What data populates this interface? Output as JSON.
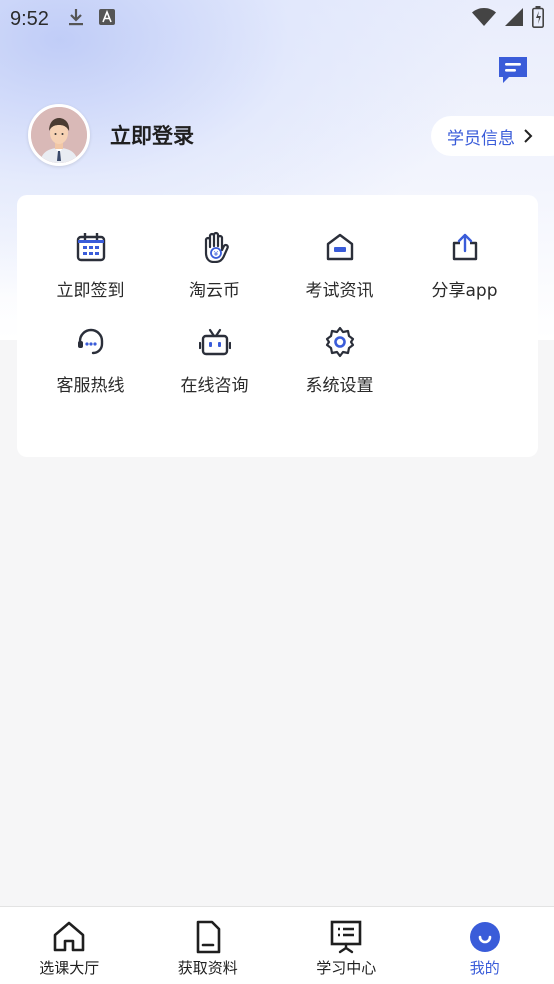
{
  "status_bar": {
    "time": "9:52",
    "left_icons": [
      "download-icon",
      "font-a-icon"
    ],
    "right_icons": [
      "wifi-icon",
      "signal-icon",
      "battery-icon"
    ]
  },
  "header": {
    "login_label": "立即登录",
    "student_info_label": "学员信息",
    "message_icon": "message-icon"
  },
  "menu": {
    "items": [
      {
        "label": "立即签到",
        "icon": "calendar-icon"
      },
      {
        "label": "淘云币",
        "icon": "coin-hand-icon"
      },
      {
        "label": "考试资讯",
        "icon": "house-badge-icon"
      },
      {
        "label": "分享app",
        "icon": "share-upload-icon"
      },
      {
        "label": "客服热线",
        "icon": "headset-icon"
      },
      {
        "label": "在线咨询",
        "icon": "robot-tv-icon"
      },
      {
        "label": "系统设置",
        "icon": "gear-icon"
      }
    ]
  },
  "bottom_nav": {
    "items": [
      {
        "label": "选课大厅",
        "icon": "home-icon",
        "active": false
      },
      {
        "label": "获取资料",
        "icon": "document-icon",
        "active": false
      },
      {
        "label": "学习中心",
        "icon": "board-icon",
        "active": false
      },
      {
        "label": "我的",
        "icon": "smile-icon",
        "active": true
      }
    ]
  },
  "colors": {
    "accent": "#3a5cd9",
    "icon_stroke": "#2b2f3a",
    "background": "#f6f6f7"
  }
}
